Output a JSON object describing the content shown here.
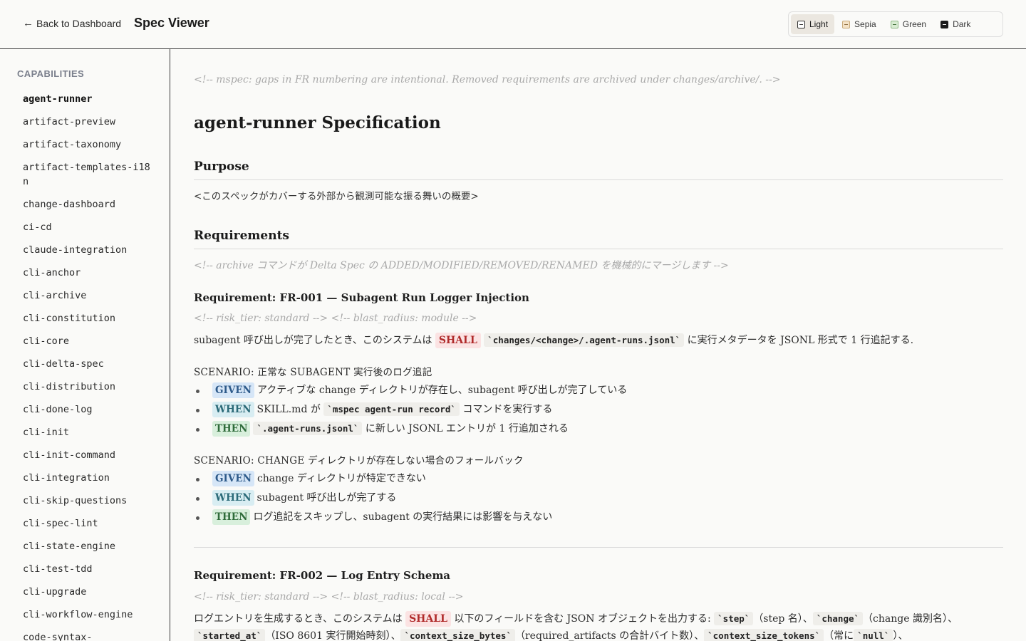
{
  "header": {
    "back_arrow": "←",
    "back_label": "Back to Dashboard",
    "app_title": "Spec Viewer",
    "themes": [
      {
        "label": "Light",
        "swatch": "#ffffff",
        "active": true
      },
      {
        "label": "Sepia",
        "swatch": "#f4e2c6",
        "active": false
      },
      {
        "label": "Green",
        "swatch": "#d8ecd2",
        "active": false
      },
      {
        "label": "Dark",
        "swatch": "#1b1b1b",
        "active": false
      }
    ]
  },
  "sidebar": {
    "heading": "CAPABILITIES",
    "items": [
      "agent-runner",
      "artifact-preview",
      "artifact-taxonomy",
      "artifact-templates-i18n",
      "change-dashboard",
      "ci-cd",
      "claude-integration",
      "cli-anchor",
      "cli-archive",
      "cli-constitution",
      "cli-core",
      "cli-delta-spec",
      "cli-distribution",
      "cli-done-log",
      "cli-init",
      "cli-init-command",
      "cli-integration",
      "cli-skip-questions",
      "cli-spec-lint",
      "cli-state-engine",
      "cli-test-tdd",
      "cli-upgrade",
      "cli-workflow-engine",
      "code-syntax-"
    ],
    "active_index": 0
  },
  "doc": {
    "top_comment": "<!-- mspec: gaps in FR numbering are intentional. Removed requirements are archived under changes/archive/. -->",
    "title": "agent-runner Specification",
    "purpose_heading": "Purpose",
    "purpose_text": "<このスペックがカバーする外部から観測可能な振る舞いの概要>",
    "requirements_heading": "Requirements",
    "requirements_comment": "<!-- archive コマンドが Delta Spec の ADDED/MODIFIED/REMOVED/RENAMED を機械的にマージします -->",
    "fr1": {
      "title": "Requirement: FR-001 — Subagent Run Logger Injection",
      "meta": "<!-- risk_tier: standard --> <!-- blast_radius: module -->",
      "text_a": "subagent 呼び出しが完了したとき、このシステムは",
      "shall": "SHALL",
      "code": "`changes/<change>/.agent-runs.jsonl`",
      "text_b": "に実行メタデータを JSONL 形式で 1 行追記する.",
      "scenario1": {
        "title": "SCENARIO: 正常な SUBAGENT 実行後のログ追記",
        "given": {
          "kw": "GIVEN",
          "text": "アクティブな change ディレクトリが存在し、subagent 呼び出しが完了している"
        },
        "when": {
          "kw": "WHEN",
          "pre": "SKILL.md が",
          "code": "`mspec agent-run record`",
          "post": "コマンドを実行する"
        },
        "then": {
          "kw": "THEN",
          "code": "`.agent-runs.jsonl`",
          "post": "に新しい JSONL エントリが 1 行追加される"
        }
      },
      "scenario2": {
        "title": "SCENARIO: CHANGE ディレクトリが存在しない場合のフォールバック",
        "given": {
          "kw": "GIVEN",
          "text": "change ディレクトリが特定できない"
        },
        "when": {
          "kw": "WHEN",
          "text": "subagent 呼び出しが完了する"
        },
        "then": {
          "kw": "THEN",
          "text": "ログ追記をスキップし、subagent の実行結果には影響を与えない"
        }
      }
    },
    "fr2": {
      "title": "Requirement: FR-002 — Log Entry Schema",
      "meta": "<!-- risk_tier: standard --> <!-- blast_radius: local -->",
      "line1_a": "ログエントリを生成するとき、このシステムは",
      "shall": "SHALL",
      "line1_b": "以下のフィールドを含む JSON オブジェクトを出力する:",
      "code_step": "`step`",
      "step_desc": "（step 名）、",
      "code_change": "`change`",
      "change_desc": "（change 識別名）、",
      "code_started": "`started_at`",
      "started_desc": "（ISO 8601 実行開始時刻）、",
      "code_bytes": "`context_size_bytes`",
      "bytes_desc": "（required_artifacts の合計バイト数）、",
      "code_tokens": "`context_size_tokens`",
      "tokens_desc": "（常に",
      "code_null": "`null`",
      "null_desc": "）、"
    }
  }
}
